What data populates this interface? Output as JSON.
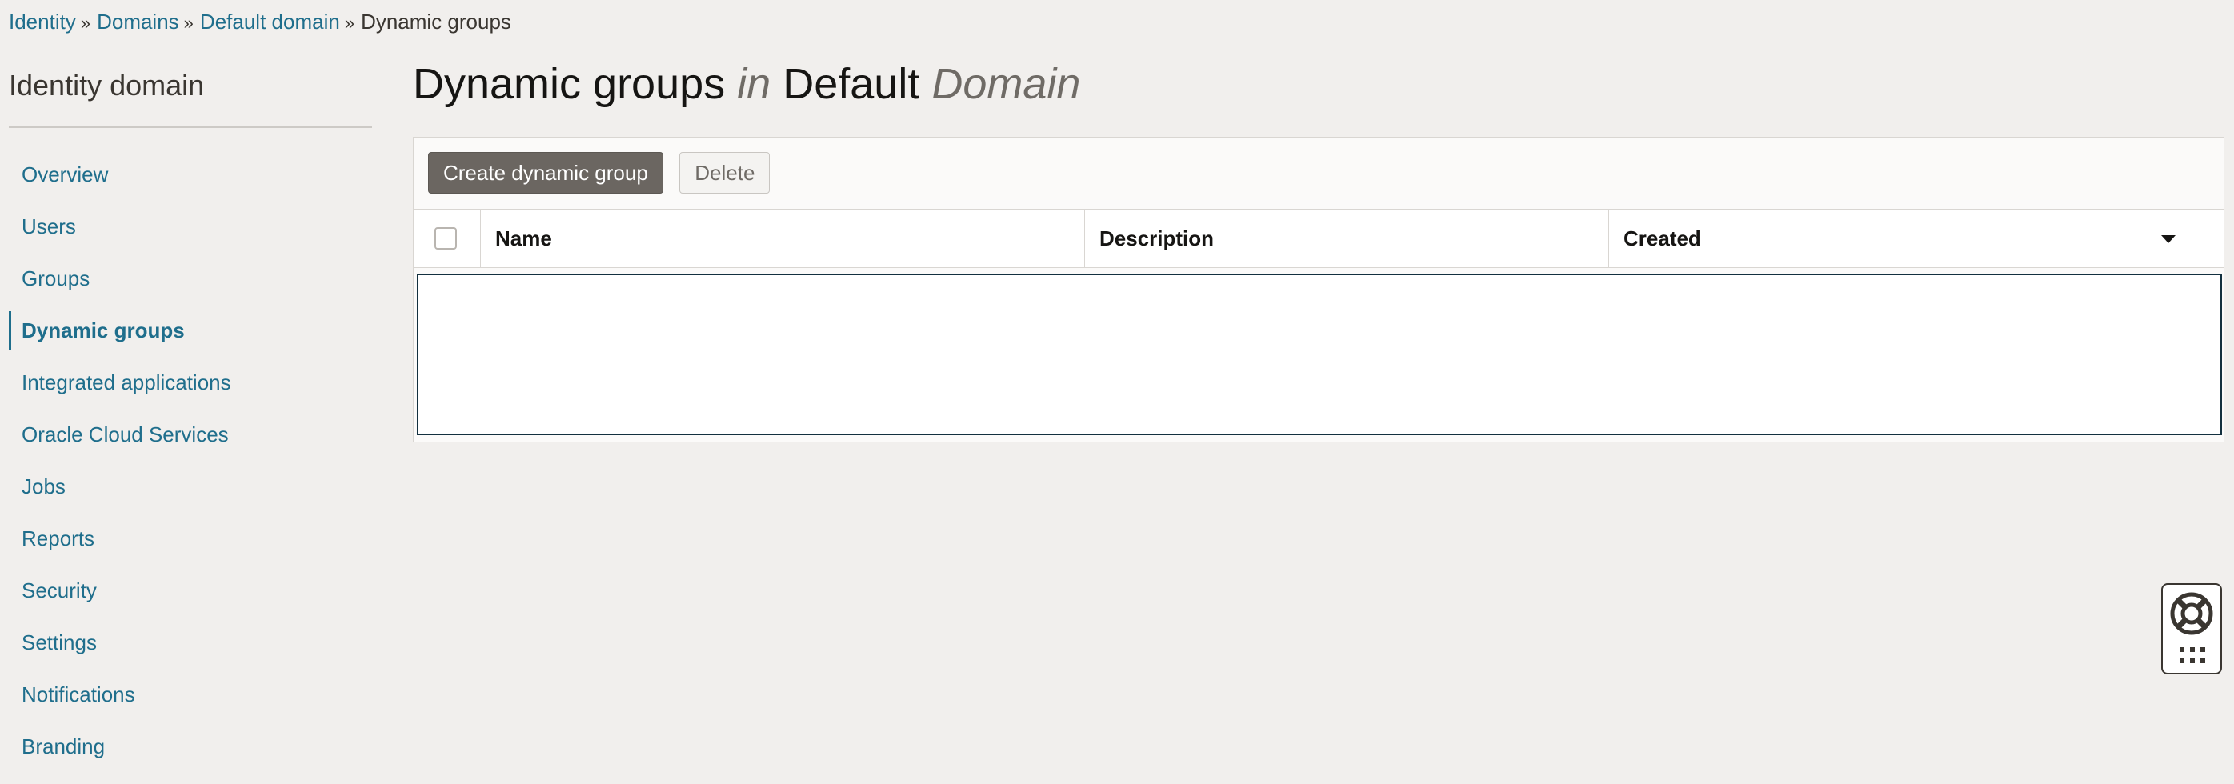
{
  "breadcrumb": {
    "items": [
      "Identity",
      "Domains",
      "Default domain"
    ],
    "separator": "»",
    "current": "Dynamic groups"
  },
  "sidebar": {
    "title": "Identity domain",
    "items": [
      {
        "label": "Overview"
      },
      {
        "label": "Users"
      },
      {
        "label": "Groups"
      },
      {
        "label": "Dynamic groups",
        "active": true
      },
      {
        "label": "Integrated applications"
      },
      {
        "label": "Oracle Cloud Services"
      },
      {
        "label": "Jobs"
      },
      {
        "label": "Reports"
      },
      {
        "label": "Security"
      },
      {
        "label": "Settings"
      },
      {
        "label": "Notifications"
      },
      {
        "label": "Branding"
      }
    ]
  },
  "page": {
    "title_main": "Dynamic groups",
    "title_in": "in",
    "title_domain": "Default",
    "title_domain_suffix": "Domain"
  },
  "toolbar": {
    "create_label": "Create dynamic group",
    "delete_label": "Delete"
  },
  "table": {
    "columns": [
      "Name",
      "Description",
      "Created"
    ],
    "rows": []
  },
  "icons": {
    "help": "lifebuoy-icon",
    "apps": "grid-icon",
    "sort": "sort-desc-icon"
  },
  "colors": {
    "link": "#1f6e8c",
    "primary_button": "#6b6661",
    "background": "#f1efed"
  }
}
